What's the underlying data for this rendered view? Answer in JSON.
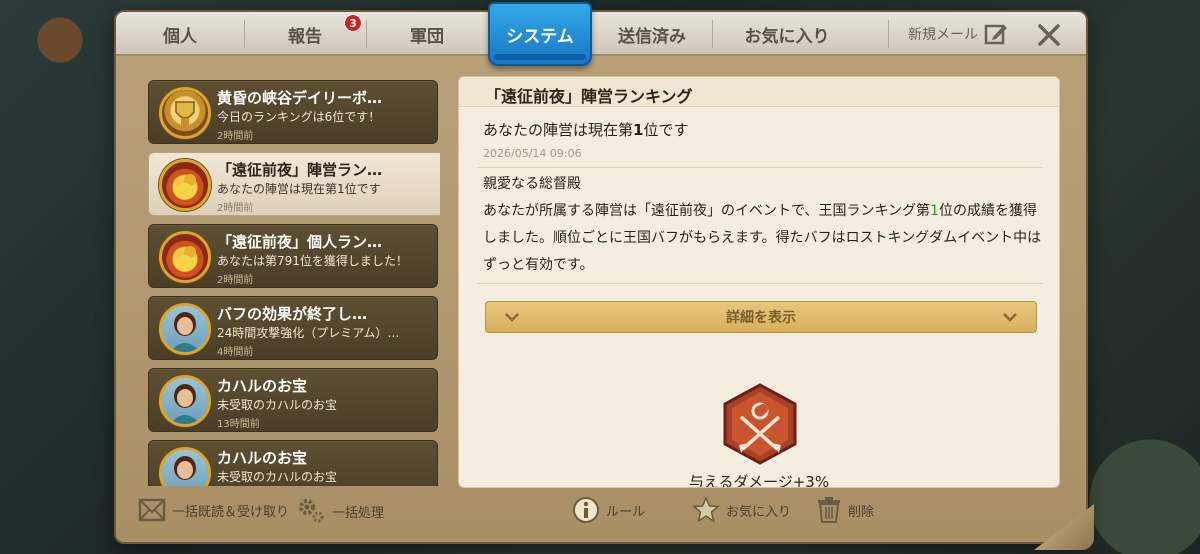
{
  "tabs": [
    {
      "label": "個人"
    },
    {
      "label": "報告",
      "badge": "3"
    },
    {
      "label": "軍団"
    },
    {
      "label": "システム",
      "active": true
    },
    {
      "label": "送信済み"
    },
    {
      "label": "お気に入り"
    }
  ],
  "header": {
    "new_mail_label": "新規メール"
  },
  "mail_list": [
    {
      "title": "黄昏の峡谷デイリーボ…",
      "preview": "今日のランキングは6位です！",
      "time": "2時間前",
      "avatar": "trophy-shield-icon"
    },
    {
      "title": "「遠征前夜」陣営ラン…",
      "preview": "あなたの陣営は現在第1位です",
      "time": "2時間前",
      "avatar": "treasure-icon",
      "selected": true
    },
    {
      "title": "「遠征前夜」個人ラン…",
      "preview": "あなたは第791位を獲得しました！",
      "time": "2時間前",
      "avatar": "treasure-icon"
    },
    {
      "title": "バフの効果が終了し…",
      "preview": "24時間攻撃強化（プレミアム）…",
      "time": "4時間前",
      "avatar": "advisor-portrait"
    },
    {
      "title": "カハルのお宝",
      "preview": "未受取のカハルのお宝",
      "time": "13時間前",
      "avatar": "advisor-portrait"
    },
    {
      "title": "カハルのお宝",
      "preview": "未受取のカハルのお宝",
      "time": "",
      "avatar": "advisor-portrait"
    }
  ],
  "detail": {
    "title": "「遠征前夜」陣営ランキング",
    "subtitle_prefix": "あなたの陣営は現在第",
    "subtitle_rank": "1",
    "subtitle_suffix": "位です",
    "date": "2026/05/14 09:06",
    "greeting": "親愛なる総督殿",
    "body_part1": "あなたが所属する陣営は「遠征前夜」のイベントで、王国ランキング第",
    "body_rank": "1",
    "body_part2": "位の成績を獲得しました。順位ごとに王国バフがもらえます。得たバフはロストキングダムイベント中はずっと有効です。",
    "details_button": "詳細を表示",
    "bonus_text": "与えるダメージ+3%"
  },
  "footer": {
    "read_all": "一括既読＆受け取り",
    "batch": "一括処理",
    "rules": "ルール",
    "favorite": "お気に入り",
    "delete": "削除"
  },
  "colors": {
    "active_tab": "#1f8fd8",
    "badge": "#d81e1e",
    "highlight_green": "#2a9a2a",
    "details_button": "#dcb665"
  }
}
